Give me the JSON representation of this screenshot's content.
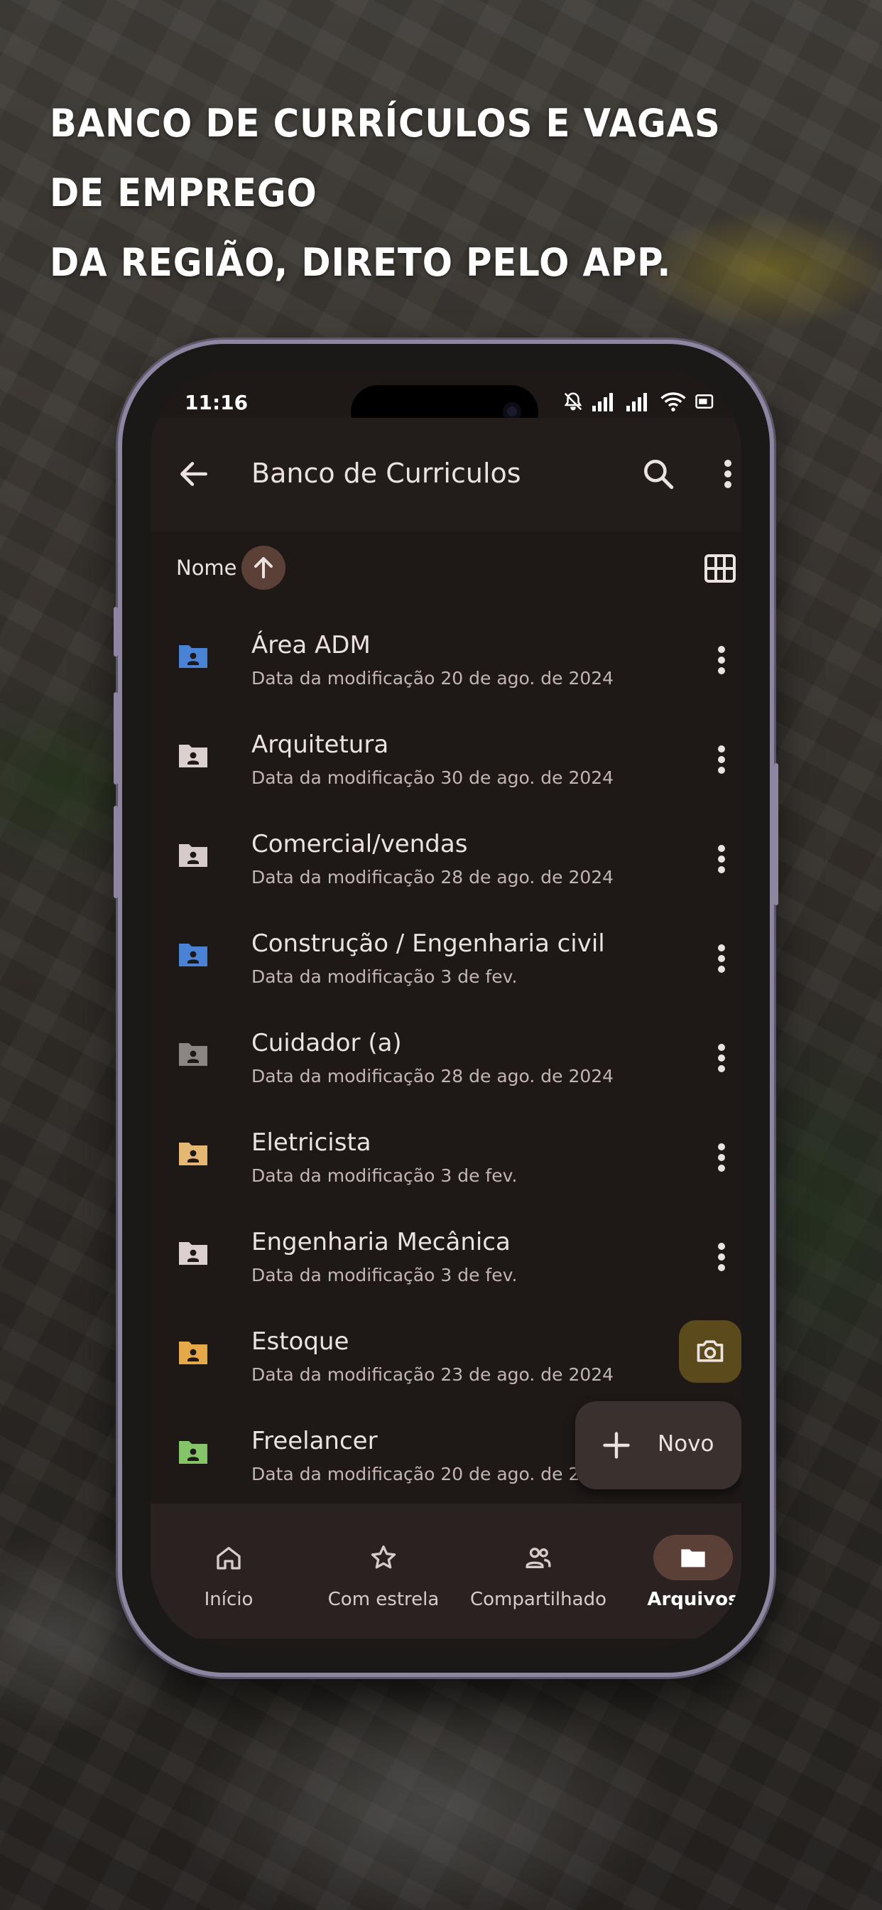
{
  "headline": {
    "line1": "BANCO DE CURRÍCULOS E VAGAS DE EMPREGO",
    "line2": "DA REGIÃO, DIRETO PELO APP."
  },
  "status_bar": {
    "time": "11:16"
  },
  "toolbar": {
    "title": "Banco de Curriculos",
    "back_icon": "arrow-back-icon",
    "search_icon": "search-icon",
    "more_icon": "more-vert-icon"
  },
  "sort": {
    "label": "Nome",
    "direction_icon": "arrow-up-icon",
    "view_icon": "grid-view-icon"
  },
  "folders": [
    {
      "name": "Área ADM",
      "meta": "Data da modificação 20 de ago. de 2024",
      "color": "#4a82d6"
    },
    {
      "name": "Arquitetura",
      "meta": "Data da modificação 30 de ago. de 2024",
      "color": "#dcd0ce"
    },
    {
      "name": "Comercial/vendas",
      "meta": "Data da modificação 28 de ago. de 2024",
      "color": "#d6cbc8"
    },
    {
      "name": "Construção / Engenharia civil",
      "meta": "Data da modificação 3 de fev.",
      "color": "#4a82d6"
    },
    {
      "name": "Cuidador (a)",
      "meta": "Data da modificação 28 de ago. de 2024",
      "color": "#8b8584"
    },
    {
      "name": "Eletricista",
      "meta": "Data da modificação 3 de fev.",
      "color": "#e4b773"
    },
    {
      "name": "Engenharia Mecânica",
      "meta": "Data da modificação 3 de fev.",
      "color": "#dcd0ce"
    },
    {
      "name": "Estoque",
      "meta": "Data da modificação 23 de ago. de 2024",
      "color": "#e6a94a"
    },
    {
      "name": "Freelancer",
      "meta": "Data da modificação 20 de ago. de 2024",
      "color": "#86c46a"
    }
  ],
  "fab": {
    "camera_icon": "camera-icon",
    "new_label": "Novo"
  },
  "bottom_nav": [
    {
      "label": "Início",
      "icon": "home-icon",
      "active": false
    },
    {
      "label": "Com estrela",
      "icon": "star-icon",
      "active": false
    },
    {
      "label": "Compartilhado",
      "icon": "people-icon",
      "active": false
    },
    {
      "label": "Arquivos",
      "icon": "folder-icon",
      "active": true
    }
  ]
}
